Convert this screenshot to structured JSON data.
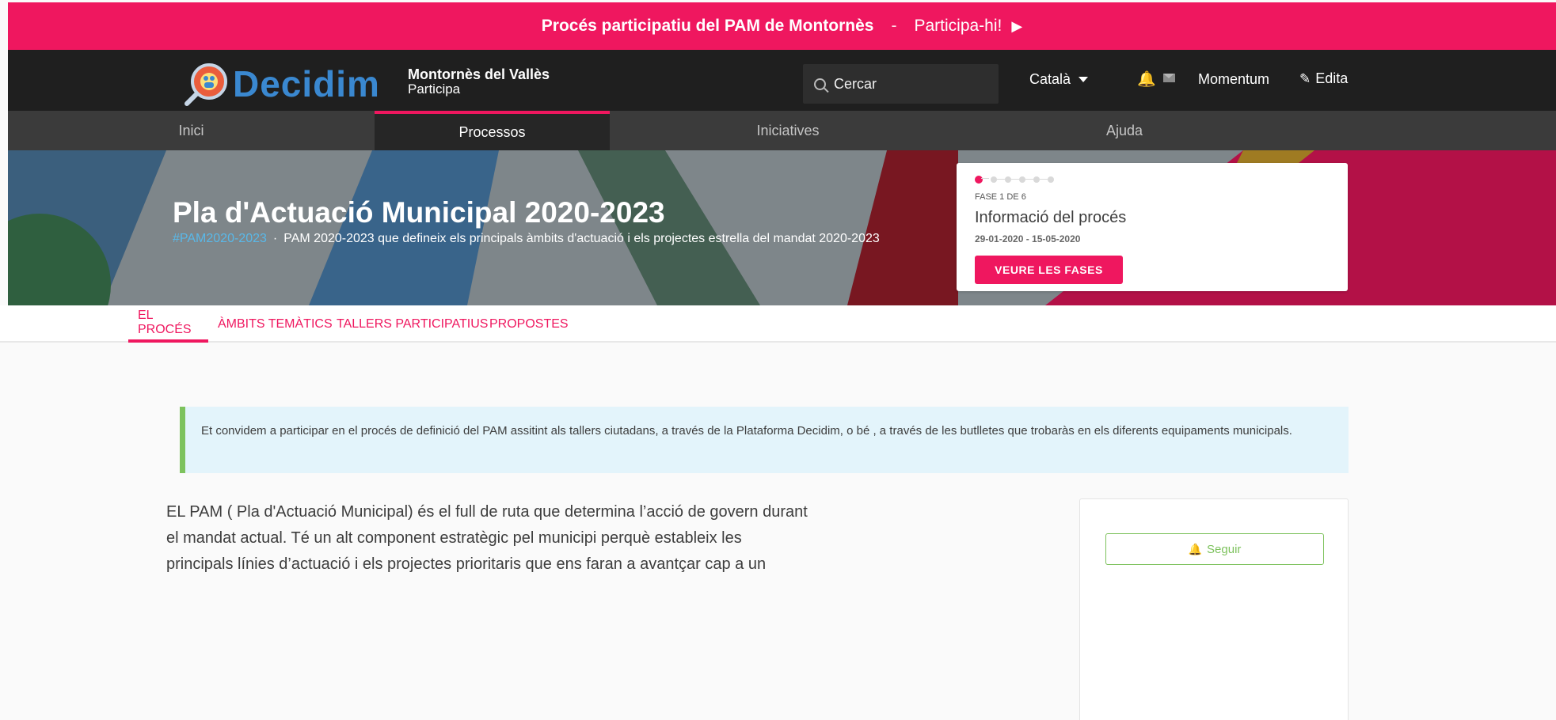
{
  "announcement": {
    "title": "Procés participatiu del PAM de Montornès",
    "separator": "-",
    "link": "Participa-hi!"
  },
  "header": {
    "logo_text": "Decidim",
    "organization": "Montornès del Vallès",
    "organization_sub": "Participa",
    "search_placeholder": "Cercar",
    "language": "Català",
    "user": "Momentum",
    "edit": "Edita"
  },
  "nav": {
    "items": [
      "Inici",
      "Processos",
      "Iniciatives",
      "Ajuda"
    ],
    "active": "Processos"
  },
  "hero": {
    "title": "Pla d'Actuació Municipal 2020-2023",
    "hashtag": "#PAM2020-2023",
    "description": "PAM 2020-2023 que defineix els principals àmbits d'actuació i els projectes estrella del mandat 2020-2023"
  },
  "phase": {
    "total": 6,
    "current": 1,
    "step_label": "FASE 1 DE 6",
    "name": "Informació del procés",
    "dates": "29-01-2020 - 15-05-2020",
    "button": "VEURE LES FASES"
  },
  "process_tabs": {
    "items": [
      "EL PROCÉS",
      "ÀMBITS TEMÀTICS",
      "TALLERS PARTICIPATIUS",
      "PROPOSTES"
    ],
    "active": "EL PROCÉS"
  },
  "callout": {
    "text": "Et convidem a participar en el procés de definició del PAM assitint als tallers ciutadans, a través de la Plataforma Decidim, o bé , a través de les butlletes que trobaràs en els diferents equipaments municipals."
  },
  "body": {
    "lines": [
      "EL PAM ( Pla d'Actuació Municipal)  és el full de ruta que determina l’acció de govern durant",
      "el mandat actual. Té un alt component estratègic pel municipi perquè estableix les",
      "principals línies d’actuació i els projectes prioritaris que ens  faran  a avantçar cap a un"
    ]
  },
  "sidebar": {
    "follow_button": "Seguir"
  },
  "colors": {
    "primary": "#ef175f",
    "header_bg": "#1f1f1f",
    "nav_bg": "#3b3b3b",
    "secondary": "#7dc25d",
    "callout_bg": "#e3f4fb",
    "logo_blue": "#3a88d0"
  },
  "icons": {
    "announcement": "play-icon",
    "search": "search-icon",
    "language": "caret-down-icon",
    "notifications": "bell-icon",
    "messages": "mail-icon",
    "edit": "pencil-icon",
    "follow": "bell-icon"
  }
}
